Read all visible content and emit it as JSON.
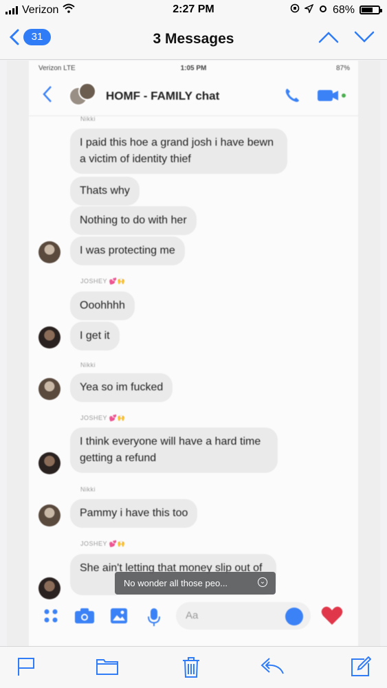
{
  "status_bar": {
    "carrier": "Verizon",
    "time": "2:27 PM",
    "battery": "68%",
    "battery_level": 0.68
  },
  "nav": {
    "badge_count": "31",
    "title": "3 Messages"
  },
  "inner_status": {
    "carrier": "Verizon  LTE",
    "time": "1:05 PM",
    "battery": "87%"
  },
  "chat": {
    "title": "HOMF - FAMILY chat",
    "senders": {
      "nikki": "Nikki",
      "joshey": "JOSHEY"
    },
    "messages": [
      "I paid this hoe a grand josh i have bewn a victim of identity thief",
      "Thats why",
      "Nothing to do with her",
      "I was protecting me",
      "Ooohhhh",
      "I get it",
      "Yea so im fucked",
      "I think everyone will have a hard time getting a refund",
      "Pammy i have this too",
      "She ain't letting that money slip out of"
    ],
    "tooltip": "No wonder all those peo...",
    "composer_placeholder": "Aa"
  },
  "colors": {
    "accent": "#2f7cf6",
    "bubble": "#eaeaea",
    "messenger_blue": "#3b82f6",
    "heart": "#e0374a"
  },
  "toolbar": {
    "icons": [
      "flag-icon",
      "folder-icon",
      "trash-icon",
      "reply-icon",
      "compose-icon"
    ]
  }
}
